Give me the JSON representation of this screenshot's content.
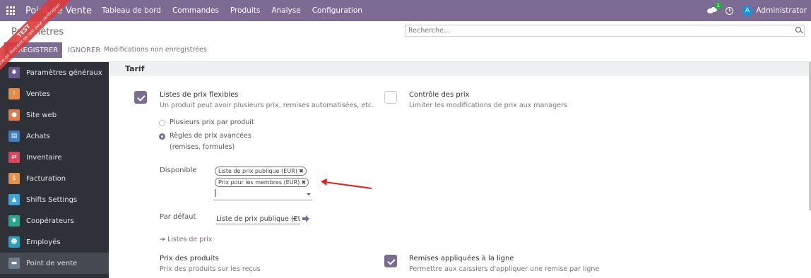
{
  "navbar": {
    "brand": "Point de Vente",
    "menu": [
      "Tableau de bord",
      "Commandes",
      "Produits",
      "Analyse",
      "Configuration"
    ],
    "chat_badge": "1",
    "user_initial": "A",
    "user_name": "Administrator",
    "accent": "#7c6b93"
  },
  "control": {
    "title": "Paramètres",
    "search_placeholder": "Recherche...",
    "save_label": "ENREGISTRER",
    "discard_label": "IGNORER",
    "unsaved_label": "Modifications non enregistrées"
  },
  "ribbon": {
    "text": "TEST",
    "subtext": "Base de données de test pour vérification"
  },
  "sidebar": {
    "items": [
      {
        "label": "Paramètres généraux",
        "icon": "gear-icon",
        "color": "#6a5a8c"
      },
      {
        "label": "Ventes",
        "icon": "chart-icon",
        "color": "#e58a47"
      },
      {
        "label": "Site web",
        "icon": "globe-icon",
        "color": "#e07b4f"
      },
      {
        "label": "Achats",
        "icon": "purchase-icon",
        "color": "#3c7cc0"
      },
      {
        "label": "Inventaire",
        "icon": "box-icon",
        "color": "#d5485a"
      },
      {
        "label": "Facturation",
        "icon": "invoice-icon",
        "color": "#e5904b"
      },
      {
        "label": "Shifts Settings",
        "icon": "bell-icon",
        "color": "#3fa3d8"
      },
      {
        "label": "Coopérateurs",
        "icon": "leaf-icon",
        "color": "#2aa58c"
      },
      {
        "label": "Employés",
        "icon": "people-icon",
        "color": "#27a0c1"
      },
      {
        "label": "Point de vente",
        "icon": "pos-icon",
        "color": "#6d7b8c"
      }
    ],
    "active_index": 9
  },
  "tarif": {
    "section_title": "Tarif",
    "flexible_title": "Listes de prix flexibles",
    "flexible_desc": "Un produit peut avoir plusieurs prix, remises automatisées, etc.",
    "flexible_checked": true,
    "radio_option_1": "Plusieurs prix par produit",
    "radio_option_2_line1": "Règles de prix avancées",
    "radio_option_2_line2": "(remises, formules)",
    "radio_selected": 2,
    "available_label": "Disponible",
    "available_tags": [
      "Liste de prix publique (EUR)",
      "Prix pour les membres (EUR)"
    ],
    "default_label": "Par défaut",
    "default_value": "Liste de prix publique (EUR)",
    "pricelists_link": "Listes de prix",
    "price_control_title": "Contrôle des prix",
    "price_control_desc": "Limiter les modifications de prix aux managers",
    "price_control_checked": false,
    "product_prices_title": "Prix des produits",
    "product_prices_desc": "Prix des produits sur les reçus",
    "line_discounts_title": "Remises appliquées à la ligne",
    "line_discounts_desc": "Permettre aux caissiers d'appliquer une remise par ligne",
    "line_discounts_checked": true
  }
}
